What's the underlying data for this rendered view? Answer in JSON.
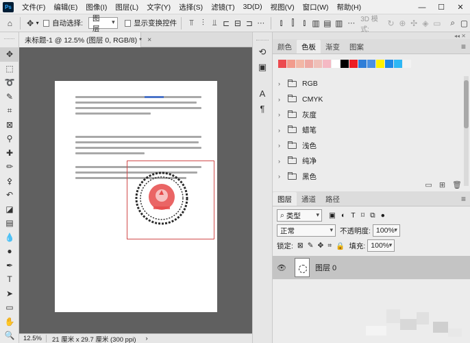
{
  "menubar": {
    "logo": "Ps",
    "items": [
      "文件(F)",
      "编辑(E)",
      "图像(I)",
      "图层(L)",
      "文字(Y)",
      "选择(S)",
      "滤镜(T)",
      "3D(D)",
      "视图(V)",
      "窗口(W)",
      "帮助(H)"
    ],
    "minimize": "—",
    "maximize": "☐",
    "close": "✕"
  },
  "options": {
    "auto_select_label": "自动选择:",
    "auto_select_value": "图层",
    "show_transform_label": "显示变换控件",
    "mode_3d_label": "3D 模式:"
  },
  "tab": {
    "title": "未标题-1 @ 12.5% (图层 0, RGB/8) *",
    "close": "×"
  },
  "status": {
    "zoom": "12.5%",
    "info": "21 厘米 x 29.7 厘米 (300 ppi)",
    "arrow": "›"
  },
  "swatch_panel": {
    "tabs": [
      "颜色",
      "色板",
      "渐变",
      "图案"
    ],
    "active_tab": "色板",
    "colors": [
      "#ec4a4f",
      "#f29b8c",
      "#f2b7a6",
      "#eea9a3",
      "#efc0b9",
      "#f5b9c4",
      "#ffffff",
      "#000000",
      "#ec1c24",
      "#2f7ed8",
      "#4a90e2",
      "#fff200",
      "#1e88e5",
      "#2db7f5",
      "#f2f2f2"
    ],
    "groups": [
      "RGB",
      "CMYK",
      "灰度",
      "蜡笔",
      "浅色",
      "纯净",
      "黑色"
    ]
  },
  "layers_panel": {
    "tabs": [
      "图层",
      "通道",
      "路径"
    ],
    "active_tab": "图层",
    "filter_label": "类型",
    "blend_mode": "正常",
    "opacity_label": "不透明度:",
    "opacity_value": "100%",
    "lock_label": "锁定:",
    "fill_label": "填充:",
    "fill_value": "100%",
    "layer_name": "图层 0"
  },
  "accent": "#d04848"
}
